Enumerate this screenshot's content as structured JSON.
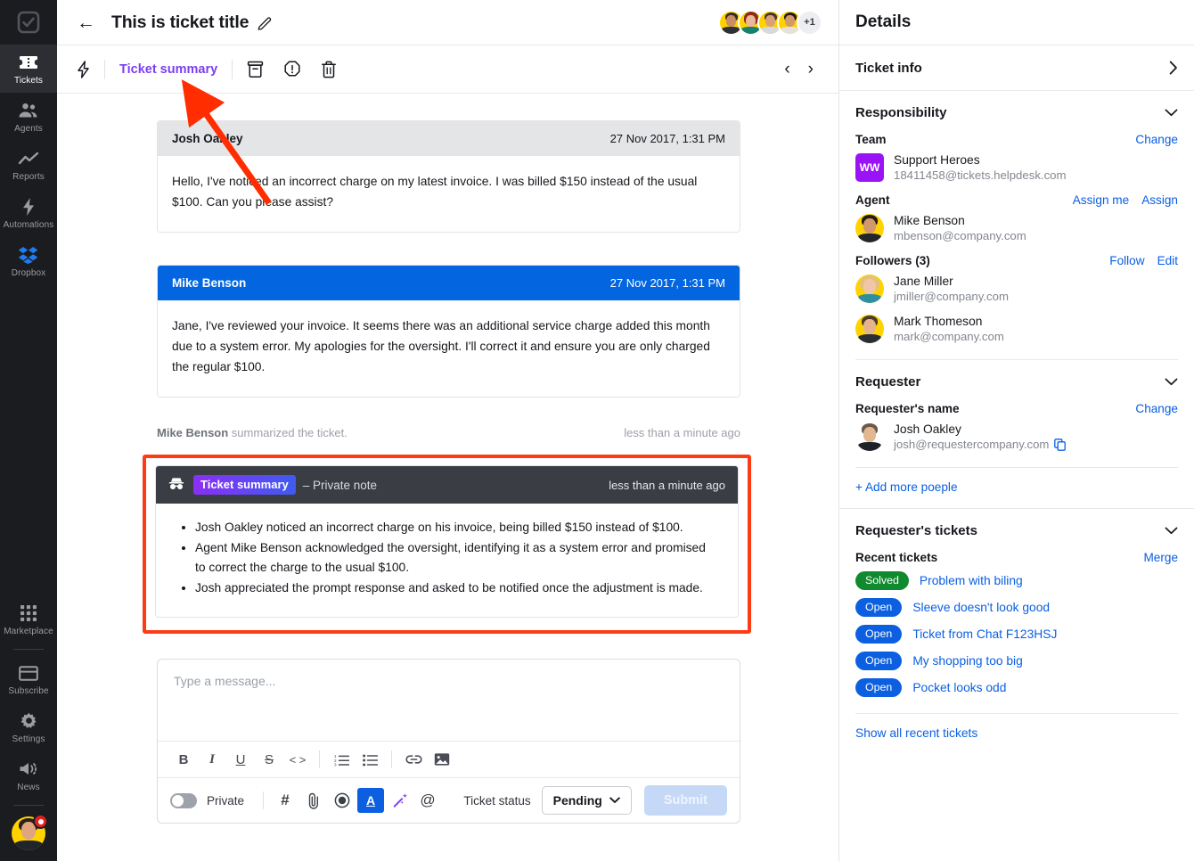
{
  "sidebar": {
    "logo_icon": "checkbox-logo-icon",
    "items": [
      {
        "label": "Tickets",
        "icon": "ticket-icon",
        "active": true
      },
      {
        "label": "Agents",
        "icon": "agents-icon",
        "active": false
      },
      {
        "label": "Reports",
        "icon": "reports-chart-icon",
        "active": false
      },
      {
        "label": "Automations",
        "icon": "lightning-bolt-icon",
        "active": false
      },
      {
        "label": "Dropbox",
        "icon": "dropbox-icon",
        "active": false
      }
    ],
    "bottom_items": [
      {
        "label": "Marketplace",
        "icon": "grid-apps-icon"
      },
      {
        "label": "Subscribe",
        "icon": "credit-card-icon"
      },
      {
        "label": "Settings",
        "icon": "gear-icon"
      },
      {
        "label": "News",
        "icon": "megaphone-icon"
      }
    ],
    "avatar_name": "user-avatar",
    "notification_dot": true
  },
  "header": {
    "back_icon": "back-arrow-icon",
    "title": "This is ticket title",
    "edit_icon": "pencil-edit-icon",
    "avatar_overflow": "+1",
    "avatar_count": 4
  },
  "toolbar": {
    "lightning_icon": "lightning-bolt-icon",
    "summary_label": "Ticket summary",
    "archive_icon": "archive-box-icon",
    "alert_icon": "alert-octagon-icon",
    "trash_icon": "trash-bin-icon",
    "prev_icon": "chevron-left-icon",
    "next_icon": "chevron-right-icon"
  },
  "thread": {
    "messages": [
      {
        "author": "Josh Oakley",
        "time": "27 Nov 2017, 1:31 PM",
        "style": "grey",
        "body": "Hello, I've noticed an incorrect charge on my latest invoice. I was billed $150 instead of the usual $100. Can you please assist?"
      },
      {
        "author": "Mike Benson",
        "time": "27 Nov 2017, 1:31 PM",
        "style": "blue",
        "body": "Jane, I've reviewed your invoice. It seems there was an additional service charge added this month due to a system error. My apologies for the oversight. I'll correct it and ensure you are only charged the regular $100."
      }
    ],
    "system_line_actor": "Mike Benson",
    "system_line_text": " summarized the ticket.",
    "system_line_time": "less than a minute ago"
  },
  "summary_card": {
    "incognito_icon": "incognito-hat-icon",
    "badge": "Ticket summary",
    "private_label": "– Private note",
    "time": "less than a minute ago",
    "bullets": [
      "Josh Oakley noticed an incorrect charge on his invoice, being billed $150 instead of $100.",
      "Agent Mike Benson acknowledged the oversight, identifying it as a system error and promised to correct the charge to the usual $100.",
      "Josh appreciated the prompt response and asked to be notified once the adjustment is made."
    ]
  },
  "composer": {
    "placeholder": "Type a message...",
    "rich_text_buttons": [
      {
        "icon": "bold-icon",
        "glyph": "B"
      },
      {
        "icon": "italic-icon",
        "glyph": "I"
      },
      {
        "icon": "underline-icon",
        "glyph": "U"
      },
      {
        "icon": "strikethrough-icon",
        "glyph": "S"
      },
      {
        "icon": "code-icon",
        "glyph": "< >"
      },
      {
        "icon": "ordered-list-icon",
        "glyph": ""
      },
      {
        "icon": "bullet-list-icon",
        "glyph": ""
      },
      {
        "icon": "link-icon",
        "glyph": ""
      },
      {
        "icon": "image-icon",
        "glyph": ""
      }
    ],
    "private_toggle_label": "Private",
    "private_toggle_on": false,
    "bottom_buttons": [
      {
        "icon": "hashtag-icon",
        "glyph": "#"
      },
      {
        "icon": "paperclip-attach-icon",
        "glyph": ""
      },
      {
        "icon": "record-circle-icon",
        "glyph": ""
      },
      {
        "icon": "text-format-icon",
        "glyph": "A",
        "selected": true
      },
      {
        "icon": "magic-wand-icon",
        "glyph": ""
      },
      {
        "icon": "mention-at-icon",
        "glyph": "@"
      }
    ],
    "status_label": "Ticket status",
    "status_value": "Pending",
    "status_chevron_icon": "chevron-down-icon",
    "submit_label": "Submit"
  },
  "details": {
    "title": "Details",
    "ticket_info_label": "Ticket info",
    "ticket_info_icon": "chevron-right-icon",
    "responsibility": {
      "title": "Responsibility",
      "collapse_icon": "chevron-down-icon",
      "team_label": "Team",
      "team_change_link": "Change",
      "team_initials": "WW",
      "team_name": "Support Heroes",
      "team_email": "18411458@tickets.helpdesk.com",
      "agent_label": "Agent",
      "agent_links": [
        "Assign me",
        "Assign"
      ],
      "agent_name": "Mike Benson",
      "agent_email": "mbenson@company.com",
      "followers_label": "Followers (3)",
      "followers_links": [
        "Follow",
        "Edit"
      ],
      "followers": [
        {
          "name": "Jane Miller",
          "email": "jmiller@company.com"
        },
        {
          "name": "Mark Thomeson",
          "email": "mark@company.com"
        }
      ]
    },
    "requester": {
      "title": "Requester",
      "collapse_icon": "chevron-down-icon",
      "name_label": "Requester's name",
      "change_link": "Change",
      "name": "Josh Oakley",
      "email": "josh@requestercompany.com",
      "copy_icon": "copy-icon",
      "add_people_link": "+ Add more poeple"
    },
    "requester_tickets": {
      "title": "Requester's tickets",
      "collapse_icon": "chevron-down-icon",
      "recent_label": "Recent tickets",
      "merge_link": "Merge",
      "tickets": [
        {
          "status": "Solved",
          "status_type": "solved",
          "title": "Problem with biling"
        },
        {
          "status": "Open",
          "status_type": "open",
          "title": "Sleeve doesn't look good"
        },
        {
          "status": "Open",
          "status_type": "open",
          "title": "Ticket from Chat F123HSJ"
        },
        {
          "status": "Open",
          "status_type": "open",
          "title": "My shopping too big"
        },
        {
          "status": "Open",
          "status_type": "open",
          "title": "Pocket looks odd"
        }
      ],
      "show_all_link": "Show all recent tickets"
    }
  },
  "annotation": {
    "arrow_color": "#ff2d00",
    "highlight_color": "#fc3c14"
  },
  "colors": {
    "accent_purple": "#7b3ff2",
    "accent_blue": "#0b5fe0",
    "message_blue": "#0366e0",
    "green": "#0f8a2e",
    "sidebar_bg": "#1b1c1f"
  }
}
